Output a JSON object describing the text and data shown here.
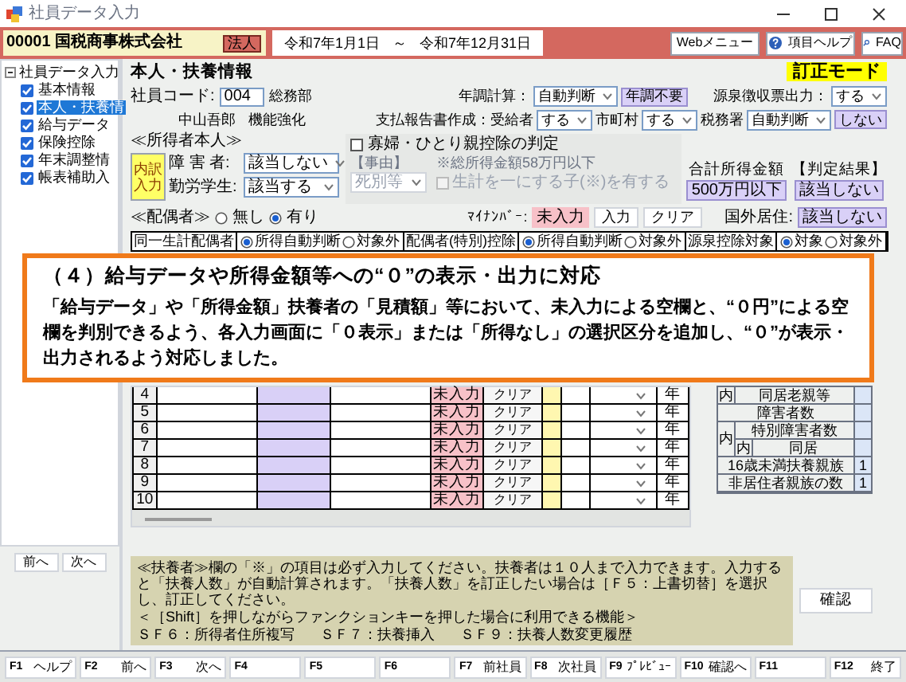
{
  "window": {
    "title": "社員データ入力"
  },
  "header": {
    "company": "00001 国税商事株式会社",
    "entity_badge": "法人",
    "period_start": "令和7年1月1日",
    "period_separator": "～",
    "period_end": "令和7年12月31日",
    "buttons": [
      {
        "kind": "plain",
        "label": "Webメニュー"
      },
      {
        "kind": "help",
        "label": "項目ヘルプ"
      },
      {
        "kind": "faq",
        "label": "FAQ"
      }
    ]
  },
  "sidebar": {
    "root": {
      "label": "社員データ入力",
      "expanded": true,
      "children": [
        {
          "label": "基本情報",
          "checked": true,
          "selected": false
        },
        {
          "label": "本人・扶養情",
          "checked": true,
          "selected": true
        },
        {
          "label": "給与データ",
          "checked": true,
          "selected": false
        },
        {
          "label": "保険控除",
          "checked": true,
          "selected": false
        },
        {
          "label": "年末調整情",
          "checked": true,
          "selected": false
        },
        {
          "label": "帳表補助入",
          "checked": true,
          "selected": false
        }
      ]
    },
    "buttons": [
      "前へ",
      "次へ"
    ]
  },
  "mode_badge": "訂正モード",
  "section_title": "本人・扶養情報",
  "employee": {
    "code_label": "社員コード:",
    "code": "004",
    "department": "総務部",
    "name": "中山吾郎",
    "note": "機能強化"
  },
  "settings": [
    [
      {
        "kind": "label",
        "text": "年調計算："
      },
      {
        "kind": "select",
        "text": "自動判断"
      },
      {
        "kind": "badge",
        "text": "年調不要"
      },
      {
        "kind": "gap"
      },
      {
        "kind": "label",
        "text": "源泉徴収票出力："
      },
      {
        "kind": "select",
        "text": "する"
      }
    ],
    [
      {
        "kind": "label",
        "text": "支払報告書作成：受給者"
      },
      {
        "kind": "select",
        "text": "する"
      },
      {
        "kind": "label",
        "text": "市町村"
      },
      {
        "kind": "select",
        "text": "する"
      },
      {
        "kind": "label",
        "text": "税務署"
      },
      {
        "kind": "select",
        "text": "自動判断"
      },
      {
        "kind": "badge",
        "text": "しない"
      }
    ]
  ],
  "taxpayer": {
    "heading": "≪所得者本人≫",
    "breakdown_button": "内訳入力",
    "fields": [
      {
        "label": "障 害 者:",
        "value": "該当しない"
      },
      {
        "label": "勤労学生:",
        "value": "該当する"
      }
    ],
    "widow": {
      "label": "寡婦・ひとり親控除の判定",
      "checked": false,
      "reason_label": "【事由】",
      "reason": "死別等",
      "reason_disabled": true,
      "note": "※総所得金額58万円以下",
      "child_label": "生計を一にする子(※)を有する",
      "child_checked": false,
      "child_disabled": true
    },
    "total_income": {
      "label": "合計所得金額",
      "value": "500万円以下"
    },
    "result": {
      "label": "【判定結果】",
      "value": "該当しない"
    }
  },
  "spouse": {
    "heading": "≪配偶者≫",
    "options": [
      {
        "label": "無し",
        "selected": false
      },
      {
        "label": "有り",
        "selected": true
      }
    ],
    "mynumber_label": "ﾏｲﾅﾝﾊﾞｰ:",
    "mynumber_status": "未入力",
    "buttons": [
      "入力",
      "クリア"
    ],
    "overseas_label": "国外居住:",
    "overseas_value": "該当しない"
  },
  "spouse_flags": [
    {
      "label": "同一生計配偶者",
      "options": [
        {
          "label": "所得自動判断",
          "selected": true
        },
        {
          "label": "対象外",
          "selected": false
        }
      ]
    },
    {
      "label": "配偶者(特別)控除",
      "options": [
        {
          "label": "所得自動判断",
          "selected": true
        },
        {
          "label": "対象外",
          "selected": false
        }
      ]
    },
    {
      "label": "源泉控除対象",
      "options": [
        {
          "label": "対象",
          "selected": true
        },
        {
          "label": "対象外",
          "selected": false
        }
      ]
    }
  ],
  "notice": {
    "title": "（４）給与データや所得金額等への“０”の表示・出力に対応",
    "body": "「給与データ」や「所得金額」扶養者の「見積額」等において、未入力による空欄と、“０円”による空欄を判別できるよう、各入力画面に「０表示」または「所得なし」の選択区分を追加し、“０”が表示・出力されるよう対応しました。"
  },
  "dependents": {
    "rows": [
      {
        "no": "4",
        "mynumber_status": "未入力",
        "clear_button": "クリア",
        "unit": "年"
      },
      {
        "no": "5",
        "mynumber_status": "未入力",
        "clear_button": "クリア",
        "unit": "年"
      },
      {
        "no": "6",
        "mynumber_status": "未入力",
        "clear_button": "クリア",
        "unit": "年"
      },
      {
        "no": "7",
        "mynumber_status": "未入力",
        "clear_button": "クリア",
        "unit": "年"
      },
      {
        "no": "8",
        "mynumber_status": "未入力",
        "clear_button": "クリア",
        "unit": "年"
      },
      {
        "no": "9",
        "mynumber_status": "未入力",
        "clear_button": "クリア",
        "unit": "年"
      },
      {
        "no": "10",
        "mynumber_status": "未入力",
        "clear_button": "クリア",
        "unit": "年"
      }
    ]
  },
  "counts": [
    {
      "kind": "item",
      "prefix": "内",
      "label": "同居老親等"
    },
    {
      "kind": "item",
      "label": "障害者数"
    },
    {
      "kind": "group",
      "prefix": "内",
      "items": [
        {
          "label": "特別障害者数"
        },
        {
          "prefix": "内",
          "label": "同居"
        }
      ]
    },
    {
      "kind": "item",
      "label": "16歳未満扶養親族",
      "value": "1"
    },
    {
      "kind": "item",
      "label": "非居住者親族の数",
      "value": "1"
    }
  ],
  "help_text": {
    "paragraph": "≪扶養者≫欄の「※」の項目は必ず入力してください。扶養者は１０人まで入力できます。入力すると「扶養人数」が自動計算されます。「扶養人数」を訂正したい場合は［Ｆ５：上書切替］を選択し、訂正してください。",
    "functions_heading": "＜［Shift］を押しながらファンクションキーを押した場合に利用できる機能＞",
    "functions": [
      "ＳＦ６：所得者住所複写",
      "ＳＦ７：扶養挿入",
      "ＳＦ９：扶養人数変更履歴"
    ]
  },
  "confirm_button": "確認",
  "function_keys": [
    {
      "key": "F1",
      "label": "ヘルプ"
    },
    {
      "key": "F2",
      "label": "前へ"
    },
    {
      "key": "F3",
      "label": "次へ"
    },
    {
      "key": "F4"
    },
    {
      "key": "F5"
    },
    {
      "key": "F6"
    },
    {
      "key": "F7",
      "label": "前社員"
    },
    {
      "key": "F8",
      "label": "次社員"
    },
    {
      "key": "F9",
      "label": "ﾌﾟﾚﾋﾞｭｰ"
    },
    {
      "key": "F10",
      "label": "確認へ"
    },
    {
      "key": "F11"
    },
    {
      "key": "F12",
      "label": "終了"
    }
  ]
}
